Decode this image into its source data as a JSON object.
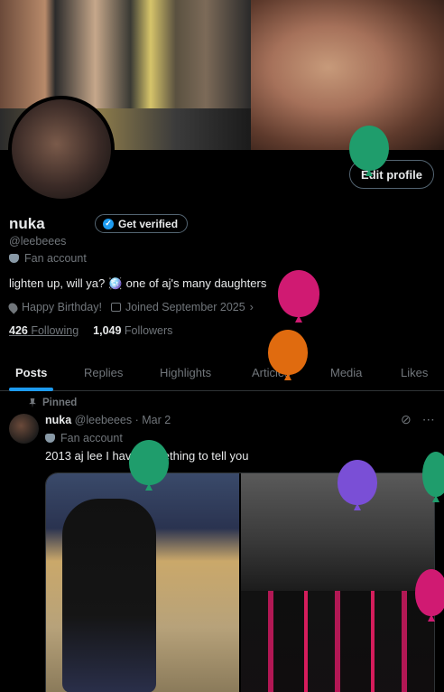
{
  "profile": {
    "display_name": "nuka",
    "get_verified_label": "Get verified",
    "handle": "@leebeees",
    "category": "Fan account",
    "bio": "lighten up, will ya? 🪩 one of aj's many daughters",
    "location": "Happy Birthday!",
    "joined": "Joined September 2025",
    "following_count": "426",
    "following_label": "Following",
    "followers_count": "1,049",
    "followers_label": "Followers",
    "edit_profile_label": "Edit profile"
  },
  "tabs": [
    {
      "label": "Posts"
    },
    {
      "label": "Replies"
    },
    {
      "label": "Highlights"
    },
    {
      "label": "Articles"
    },
    {
      "label": "Media"
    },
    {
      "label": "Likes"
    }
  ],
  "post": {
    "pinned_label": "Pinned",
    "author": "nuka",
    "handle_date": "@leebeees · Mar 2",
    "category": "Fan account",
    "text": "2013 aj lee I have something to tell you",
    "more_icon": "⋯"
  },
  "icons": {
    "verified": "badge-check-icon",
    "fan": "mask-icon",
    "location": "map-pin-icon",
    "calendar": "calendar-icon",
    "pin": "pin-icon",
    "grok": "grok-icon",
    "more": "more-icon"
  },
  "colors": {
    "accent": "#1d9bf0",
    "muted": "#71767b",
    "text": "#e7e9ea",
    "background": "#000000",
    "balloon_green": "#1f9d6c",
    "balloon_pink": "#d01a72",
    "balloon_orange": "#e06b0f",
    "balloon_purple": "#7a4fd6"
  }
}
